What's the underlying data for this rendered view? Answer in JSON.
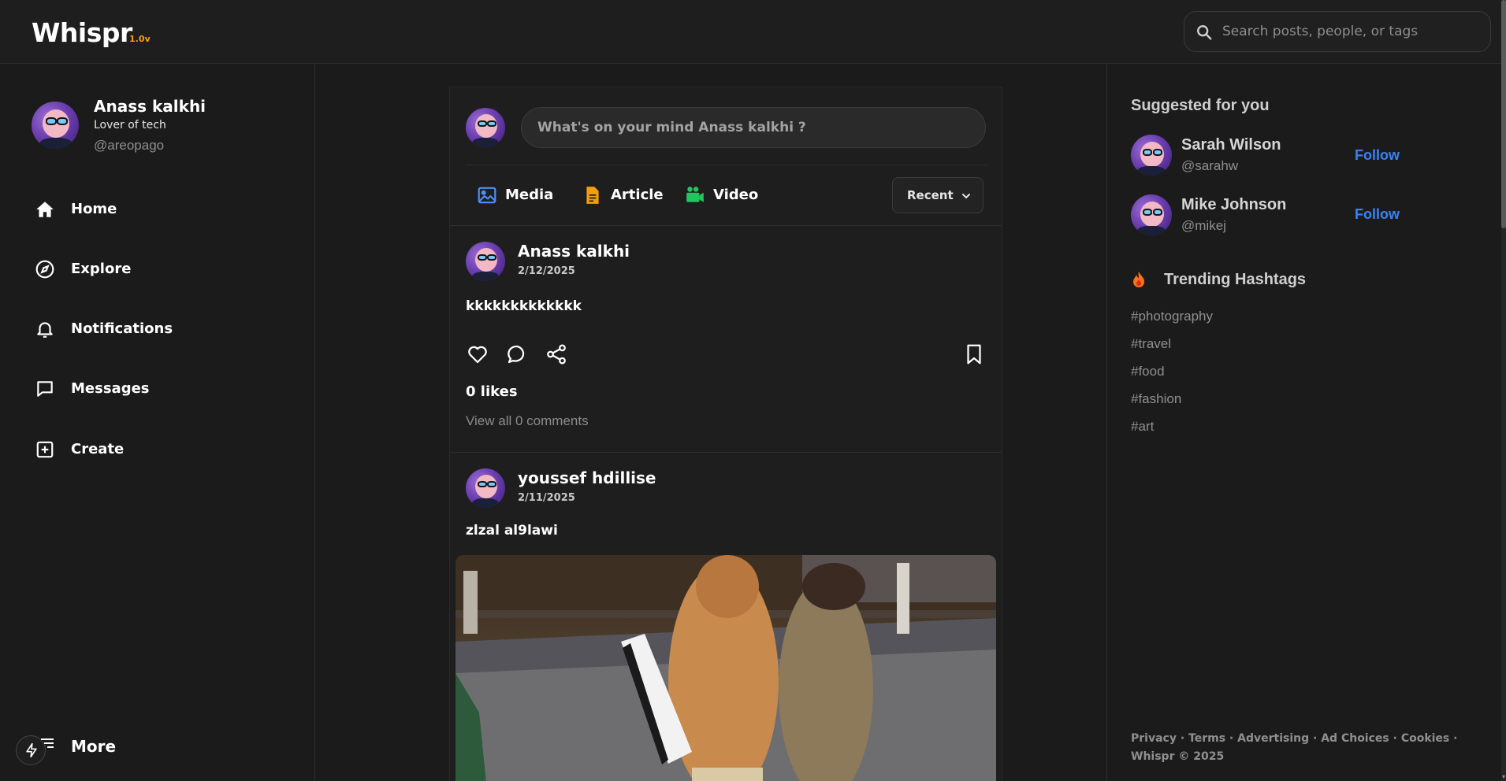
{
  "header": {
    "logo": "Whispr",
    "version": "1.0v",
    "search_placeholder": "Search posts, people, or tags"
  },
  "profile": {
    "name": "Anass kalkhi",
    "bio": "Lover of tech",
    "handle": "@areopago"
  },
  "nav": {
    "items": [
      {
        "label": "Home",
        "icon": "home-icon"
      },
      {
        "label": "Explore",
        "icon": "compass-icon"
      },
      {
        "label": "Notifications",
        "icon": "bell-icon"
      },
      {
        "label": "Messages",
        "icon": "message-square-icon"
      },
      {
        "label": "Create",
        "icon": "plus-square-icon"
      }
    ],
    "more_label": "More"
  },
  "composer": {
    "placeholder": "What's on your mind Anass kalkhi ?",
    "media_label": "Media",
    "article_label": "Article",
    "video_label": "Video",
    "sort_label": "Recent"
  },
  "posts": [
    {
      "author": "Anass kalkhi",
      "date": "2/12/2025",
      "text": "kkkkkkkkkkkkk",
      "likes": "0 likes",
      "comments": "View all 0 comments"
    },
    {
      "author": "youssef hdillise",
      "date": "2/11/2025",
      "text": "zlzal al9lawi",
      "has_image": true
    }
  ],
  "suggested": {
    "title": "Suggested for you",
    "follow_label": "Follow",
    "users": [
      {
        "name": "Sarah Wilson",
        "handle": "@sarahw"
      },
      {
        "name": "Mike Johnson",
        "handle": "@mikej"
      }
    ]
  },
  "trending": {
    "title": "Trending Hashtags",
    "tags": [
      "#photography",
      "#travel",
      "#food",
      "#fashion",
      "#art"
    ]
  },
  "footer": {
    "links": [
      "Privacy",
      "Terms",
      "Advertising",
      "Ad Choices",
      "Cookies"
    ],
    "copyright": "Whispr © 2025"
  },
  "colors": {
    "background": "#1b1b1b",
    "accent_version": "#f59e0b",
    "follow": "#3b82f6",
    "media_icon": "#4f8ef7",
    "article_icon": "#f59e0b",
    "video_icon": "#22c55e"
  }
}
